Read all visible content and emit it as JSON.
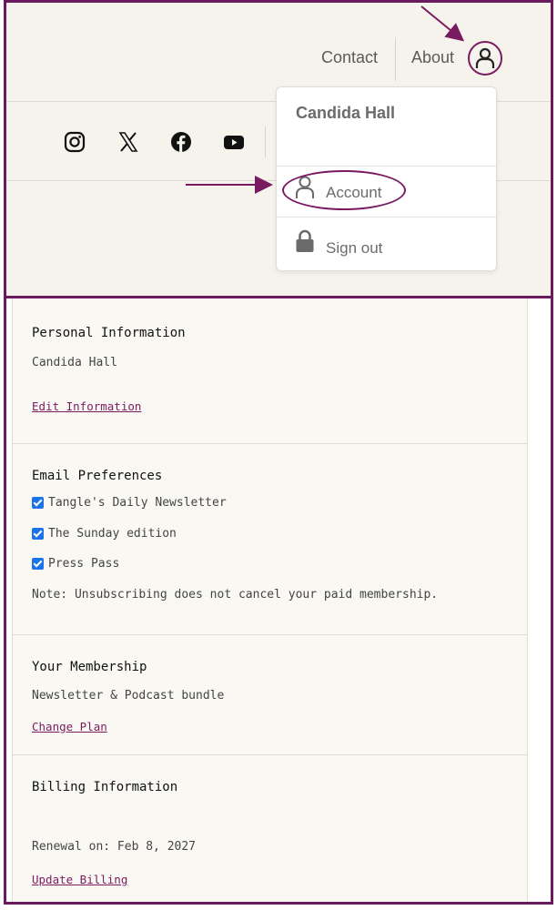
{
  "header": {
    "nav": {
      "contact": "Contact",
      "about": "About"
    },
    "social_icons": [
      "instagram-icon",
      "x-icon",
      "facebook-icon",
      "youtube-icon"
    ]
  },
  "user_menu": {
    "name": "Candida Hall",
    "items": [
      {
        "label": "Account",
        "icon": "user-icon"
      },
      {
        "label": "Sign out",
        "icon": "lock-icon"
      }
    ]
  },
  "account": {
    "personal": {
      "title": "Personal Information",
      "name": "Candida Hall",
      "edit_link": "Edit Information"
    },
    "email": {
      "title": "Email Preferences",
      "options": [
        {
          "label": "Tangle's Daily Newsletter",
          "checked": true
        },
        {
          "label": "The Sunday edition",
          "checked": true
        },
        {
          "label": "Press Pass",
          "checked": true
        }
      ],
      "note": "Note: Unsubscribing does not cancel your paid membership."
    },
    "membership": {
      "title": "Your Membership",
      "plan": "Newsletter & Podcast bundle",
      "change_link": "Change Plan"
    },
    "billing": {
      "title": "Billing Information",
      "renewal": "Renewal on: Feb 8, 2027",
      "update_link": "Update Billing"
    }
  },
  "colors": {
    "accent": "#7a1b62",
    "frame": "#6b1a5d",
    "header_bg": "#f5f3ec",
    "page_bg": "#faf8f3",
    "checkbox": "#1a73e8"
  }
}
